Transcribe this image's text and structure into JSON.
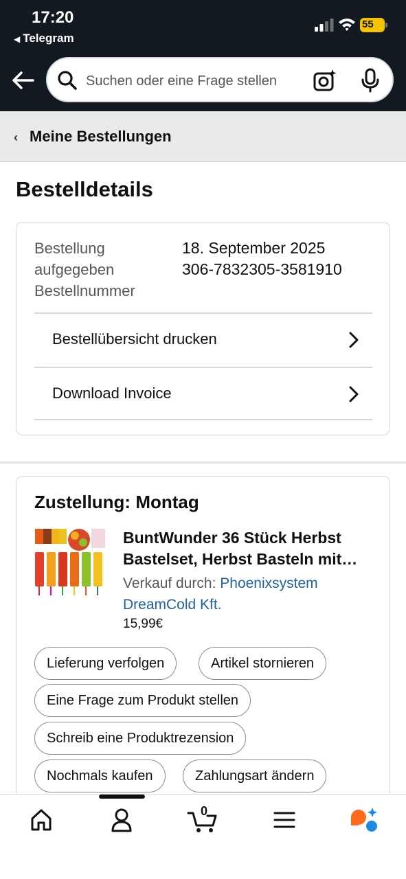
{
  "status_bar": {
    "time": "17:20",
    "back_app": "Telegram",
    "battery": "55"
  },
  "search": {
    "placeholder": "Suchen oder eine Frage stellen"
  },
  "breadcrumb": {
    "label": "Meine Bestellungen"
  },
  "page_title": "Bestelldetails",
  "order": {
    "labels": [
      "Bestellung",
      "aufgegeben",
      "Bestellnummer"
    ],
    "date": "18. September 2025",
    "number": "306-7832305-3581910",
    "actions": [
      "Bestellübersicht drucken",
      "Download Invoice"
    ]
  },
  "delivery": {
    "heading": "Zustellung: Montag",
    "product": {
      "title_line1": "BuntWunder 36 Stück Herbst",
      "title_line2": "Bastelset, Herbst Basteln mit…",
      "sold_by_label": "Verkauf durch:",
      "seller_line1": "Phoenixsystem",
      "seller_line2": "DreamCold Kft.",
      "price": "15,99€"
    },
    "buttons": [
      "Lieferung verfolgen",
      "Artikel stornieren",
      "Eine Frage zum Produkt stellen",
      "Schreib eine Produktrezension",
      "Nochmals kaufen",
      "Zahlungsart ändern"
    ]
  },
  "bottom_nav": {
    "cart_count": "0",
    "items": [
      "home-icon",
      "account-icon",
      "cart-icon",
      "menu-icon",
      "rufus-ai-icon"
    ]
  },
  "colors": {
    "header_bg": "#131921",
    "link": "#2162a1",
    "battery": "#f5c400",
    "ai_orange": "#ff6a1a",
    "ai_blue": "#1e88e5"
  }
}
